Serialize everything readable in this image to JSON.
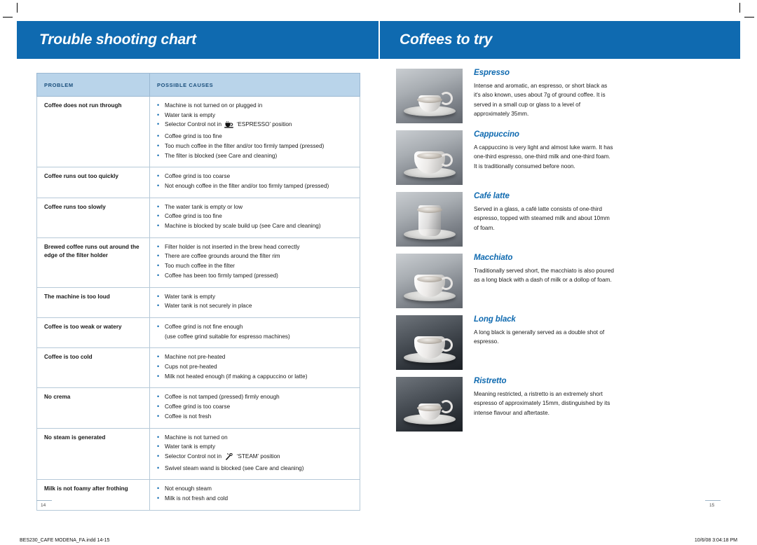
{
  "header": {
    "left_title": "Trouble shooting chart",
    "right_title": "Coffees to try"
  },
  "table": {
    "columns": [
      "PROBLEM",
      "POSSIBLE CAUSES"
    ],
    "rows": [
      {
        "problem": "Coffee does not run through",
        "causes": [
          "Machine is not turned on or plugged in",
          "Water tank is empty",
          "Selector Control not in  ‘ESPRESSO’ position",
          "Coffee grind is too fine",
          "Too much coffee in the filter and/or too firmly tamped (pressed)",
          "The filter is blocked (see Care and cleaning)"
        ]
      },
      {
        "problem": "Coffee runs out too quickly",
        "causes": [
          "Coffee grind is too coarse",
          "Not enough coffee in the filter and/or too firmly tamped (pressed)"
        ]
      },
      {
        "problem": "Coffee runs too slowly",
        "causes": [
          "The water tank is empty or low",
          "Coffee grind is too fine",
          "Machine is blocked by scale build up (see Care and cleaning)"
        ]
      },
      {
        "problem": "Brewed coffee runs out around the edge of the filter holder",
        "causes": [
          "Filter holder is not inserted in the brew head correctly",
          "There are coffee grounds around the filter rim",
          "Too much coffee in the filter",
          "Coffee has been too firmly tamped (pressed)"
        ]
      },
      {
        "problem": "The machine is too loud",
        "causes": [
          "Water tank is empty",
          "Water tank is not securely in place"
        ]
      },
      {
        "problem": "Coffee is too weak or watery",
        "causes": [
          "Coffee grind is not fine enough",
          "(use coffee grind suitable for espresso machines)"
        ]
      },
      {
        "problem": "Coffee is too cold",
        "causes": [
          "Machine not pre-heated",
          "Cups not pre-heated",
          "Milk not heated enough (if making a cappuccino or latte)"
        ]
      },
      {
        "problem": "No crema",
        "causes": [
          "Coffee is not tamped (pressed) firmly enough",
          "Coffee grind is too coarse",
          "Coffee is not fresh"
        ]
      },
      {
        "problem": "No steam is generated",
        "causes": [
          "Machine is not turned on",
          "Water tank is empty",
          "Selector Control not in  ‘STEAM’ position",
          "Swivel steam wand is blocked (see Care and cleaning)"
        ]
      },
      {
        "problem": "Milk is not foamy after frothing",
        "causes": [
          "Not enough steam",
          "Milk is not fresh and cold"
        ]
      }
    ]
  },
  "coffees": [
    {
      "title": "Espresso",
      "description": "Intense and aromatic, an espresso, or short black as it's also known, uses about 7g of ground coffee. It is served in a small cup or glass to a level of approximately 35mm."
    },
    {
      "title": "Cappuccino",
      "description": "A cappuccino is very light and almost luke warm. It has one-third espresso, one-third milk and one-third foam. It is traditionally consumed before noon."
    },
    {
      "title": "Café latte",
      "description": "Served in a glass, a café latte consists of one-third espresso, topped with steamed milk and about 10mm of foam."
    },
    {
      "title": "Macchiato",
      "description": "Traditionally served short, the macchiato is also poured as a long black with a dash of milk or a dollop of foam."
    },
    {
      "title": "Long black",
      "description": "A long black is generally served as a double shot of espresso."
    },
    {
      "title": "Ristretto",
      "description": "Meaning restricted, a ristretto is an extremely short espresso of approximately 15mm, distinguished by its intense flavour and aftertaste."
    }
  ],
  "page_numbers": {
    "left": "14",
    "right": "15"
  },
  "footer": {
    "left": "BES230_CAFE MODENA_FA.indd   14-15",
    "right": "10/6/08   3:04:18 PM"
  },
  "colors": {
    "brand_blue": "#0f6ab0",
    "header_cell": "#b9d4ea",
    "header_cell_text": "#1b4f7c"
  }
}
